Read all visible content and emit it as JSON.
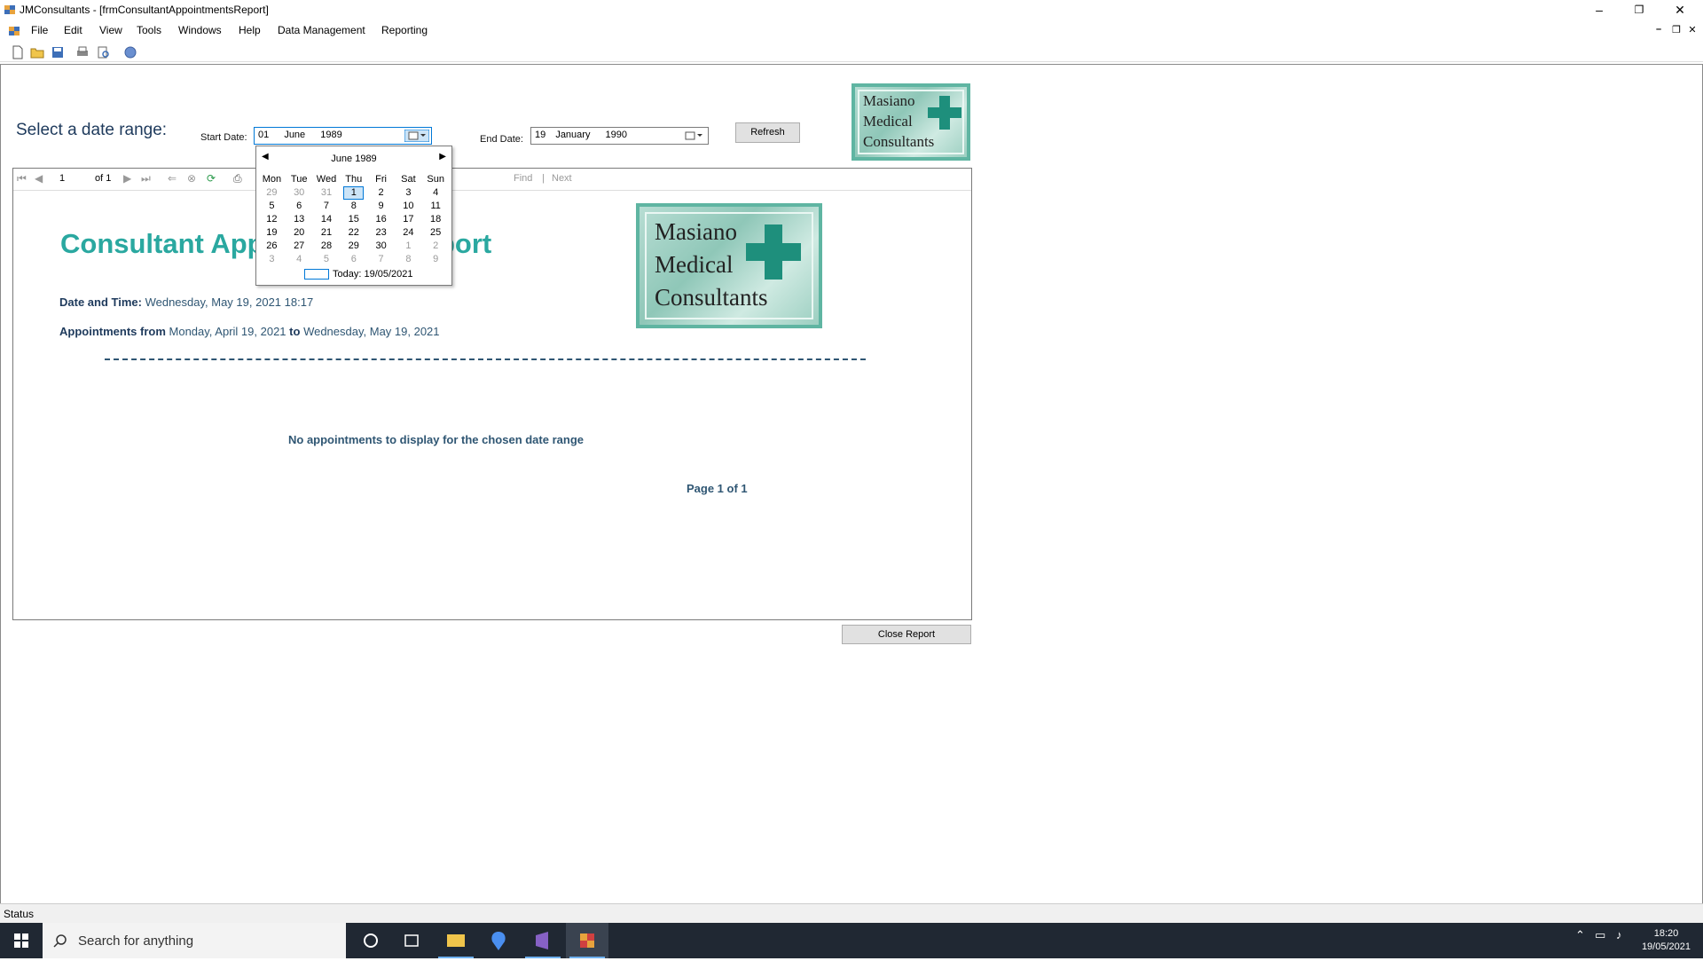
{
  "window": {
    "title": "JMConsultants - [frmConsultantAppointmentsReport]",
    "controls": [
      "–",
      "❐",
      "✕"
    ],
    "mdi_controls": [
      "–",
      "❐",
      "✕"
    ]
  },
  "menu": {
    "items": [
      "File",
      "Edit",
      "View",
      "Tools",
      "Windows",
      "Help",
      "Data Management",
      "Reporting"
    ]
  },
  "toolbar": {
    "icons": [
      "new-icon",
      "open-icon",
      "save-icon",
      "print-icon",
      "print-preview-icon",
      "help-icon"
    ]
  },
  "form": {
    "select_label": "Select a date range:",
    "start_label": "Start Date:",
    "start_value": {
      "day": "01",
      "month": "June",
      "year": "1989"
    },
    "end_label": "End Date:",
    "end_value": {
      "day": "19",
      "month": "January",
      "year": "1990"
    },
    "refresh_label": "Refresh",
    "close_label": "Close Report"
  },
  "logo": {
    "lines": [
      "Masiano",
      "Medical",
      "Consultants"
    ],
    "colors": {
      "border": "#5fb5a2",
      "cross": "#1e8f7c"
    }
  },
  "viewer": {
    "page_value": "1",
    "of_label": "of 1",
    "find_label": "Find",
    "separator": "|",
    "next_label": "Next"
  },
  "report": {
    "title": "Consultant Appointments Report",
    "date_time_label": "Date and Time:",
    "date_time_value": "Wednesday, May 19, 2021 18:17",
    "appointments_label": "Appointments from",
    "from_value": "Monday, April 19, 2021",
    "to_label": "to",
    "to_value": "Wednesday, May 19, 2021",
    "no_data": "No appointments to display for the chosen date range",
    "page_info": "Page 1 of 1",
    "colors": {
      "title": "#2aa8a0",
      "text": "#2f5673"
    }
  },
  "calendar": {
    "month_label": "June 1989",
    "days_of_week": [
      "Mon",
      "Tue",
      "Wed",
      "Thu",
      "Fri",
      "Sat",
      "Sun"
    ],
    "weeks": [
      [
        "29",
        "30",
        "31",
        "1",
        "2",
        "3",
        "4"
      ],
      [
        "5",
        "6",
        "7",
        "8",
        "9",
        "10",
        "11"
      ],
      [
        "12",
        "13",
        "14",
        "15",
        "16",
        "17",
        "18"
      ],
      [
        "19",
        "20",
        "21",
        "22",
        "23",
        "24",
        "25"
      ],
      [
        "26",
        "27",
        "28",
        "29",
        "30",
        "1",
        "2"
      ],
      [
        "3",
        "4",
        "5",
        "6",
        "7",
        "8",
        "9"
      ]
    ],
    "selected_day": "1",
    "today_label": "Today: 19/05/2021"
  },
  "status": {
    "text": "Status"
  },
  "taskbar": {
    "search_placeholder": "Search for anything",
    "time": "18:20",
    "date": "19/05/2021"
  }
}
